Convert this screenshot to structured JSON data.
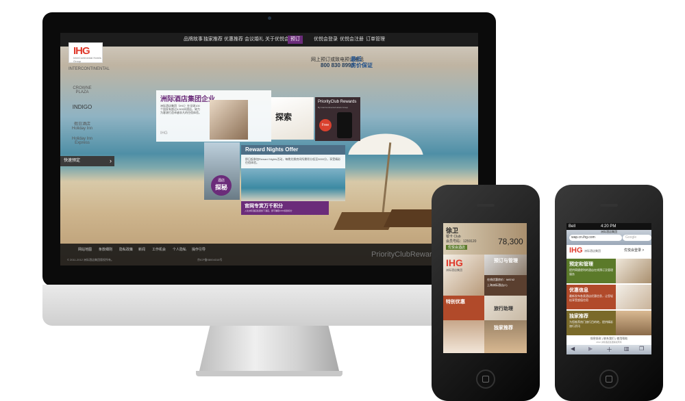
{
  "site": {
    "nav": [
      "品牌故事",
      "独家推荐",
      "优惠推荐",
      "会议婚礼",
      "关于优悦会"
    ],
    "nav_highlight": "预订",
    "member_links": [
      "优悦会登录",
      "优悦会注册",
      "订单管理"
    ],
    "logo": "IHG",
    "logo_sub": "InterContinental Hotels Group",
    "brands": [
      "INTERCONTINENTAL",
      "CROWNE PLAZA",
      "INDIGO",
      "假日酒店 Holiday Inn",
      "Holiday Inn Express"
    ],
    "phone_label": "网上预订或致电预订电话",
    "phone": "800 830 8998",
    "best_price": [
      "最低",
      "房价保证"
    ],
    "side_tab": "快速预定",
    "side_tab_sub": "QUICK ORDER",
    "hero_title": "洲际酒店集团企业",
    "hero_body": "洲际酒店集团（IHG）在全球100个国家有超过4,500间酒店，致力为客源打造卓越非凡的住宿体验。",
    "explore_label": "探索",
    "pc_rewards_title": "PriorityClub Rewards",
    "pc_rewards_sub": "By InterContinental Hotels Group",
    "free_badge": "Free",
    "reward_title": "Reward Nights Offer",
    "reward_body": "即日起参加Reward Nights活动，每晚兑换房间所需积分低至5000分，享受精彩住宿体验。",
    "secret_label": "探秘",
    "secret_top": "酒店",
    "bonus_title": "官网专赏万千积分",
    "bonus_body": "入住洲际酒店集团旗下酒店，即可赚取1000奖励积分",
    "footer_links": [
      "网站地图",
      "条款细则",
      "隐私政策",
      "新闻",
      "工作机会",
      "个人隐私",
      "操作引导"
    ],
    "copyright": "© 2011-2012 洲际酒店集团版权所有。",
    "footer_note": "京ICP备08004316号",
    "watermark": "PriorityClubRewards"
  },
  "phone1": {
    "name": "徐卫",
    "tier": "银卡 Club",
    "member_no": "会员号码：1259120",
    "points": "78,300",
    "status_chip": "优悦会酒店",
    "tiles": [
      "预订与管理",
      "特别优惠",
      "旅行助理",
      "独家推荐"
    ],
    "booking_lines": [
      "在线优惠房价：M8742",
      "上海洲际酒店(C)"
    ],
    "logo": "IHG",
    "logo_sub": "洲际酒店集团"
  },
  "phone2": {
    "carrier": "Bell",
    "time": "4:20 PM",
    "page_title": "洲际酒店集团",
    "url": "wap.cn.ihg.com",
    "search_placeholder": "Google",
    "logo": "IHG",
    "logo_sub": "洲际酒店集团",
    "login": "优悦会登录 >",
    "rows": [
      {
        "label": "预定和管理",
        "desc": "提供简捷便利的酒店在线预订及管理服务",
        "color": "#5b7a2a"
      },
      {
        "label": "优惠信息",
        "desc": "最新发布各类酒店优惠信息，让您轻松享受超值住宿",
        "color": "#b14a2a"
      },
      {
        "label": "独家推荐",
        "desc": "为您推荐热门旅行目的地，提供精彩旅行资讯",
        "color": "#7a6a2a"
      }
    ],
    "footer_links": [
      "保密条款",
      "联系我们",
      "使用帮助"
    ],
    "footer_copy": "2012 洲际酒店集团版权所有"
  },
  "colors": {
    "brand_purple": "#6b2c7a",
    "ihg_red": "#e0392b"
  }
}
